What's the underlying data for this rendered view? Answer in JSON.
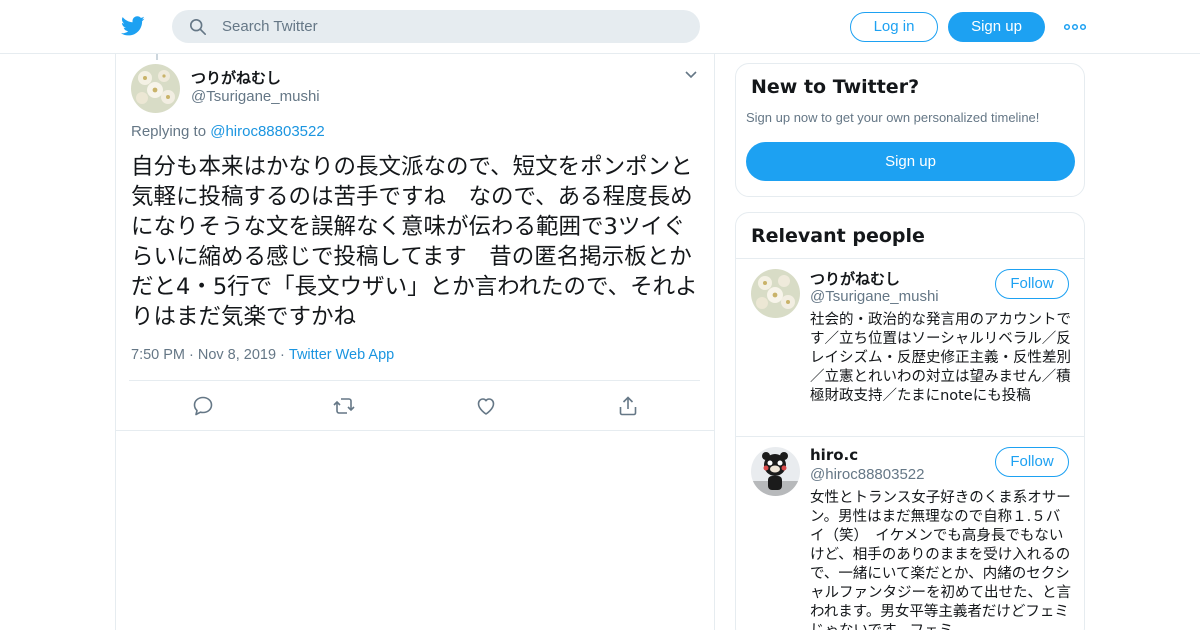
{
  "header": {
    "logo": "twitter-bird-icon",
    "search_placeholder": "Search Twitter",
    "login_label": "Log in",
    "signup_label": "Sign up",
    "more": "more-dots-icon",
    "brand_color": "#1da1f2"
  },
  "tweet": {
    "name": "つりがねむし",
    "handle": "@Tsurigane_mushi",
    "replying_prefix": "Replying to ",
    "replying_to": "@hiroc88803522",
    "text": "自分も本来はかなりの長文派なので、短文をポンポンと気軽に投稿するのは苦手ですね　なので、ある程度長めになりそうな文を誤解なく意味が伝わる範囲で3ツイぐらいに縮める感じで投稿してます　昔の匿名掲示板とかだと4・5行で「長文ウザい」とか言われたので、それよりはまだ気楽ですかね",
    "time": "7:50 PM",
    "date": "Nov 8, 2019",
    "source": "Twitter Web App",
    "separator": "·"
  },
  "sidebar": {
    "new_to_twitter": {
      "title": "New to Twitter?",
      "subtitle": "Sign up now to get your own personalized timeline!",
      "signup_label": "Sign up"
    },
    "relevant": {
      "title": "Relevant people",
      "people": [
        {
          "name": "つりがねむし",
          "handle": "@Tsurigane_mushi",
          "follow_label": "Follow",
          "bio": "社会的・政治的な発言用のアカウントです／立ち位置はソーシャルリベラル／反レイシズム・反歴史修正主義・反性差別／立憲とれいわの対立は望みません／積極財政支持／たまにnoteにも投稿"
        },
        {
          "name": "hiro.c",
          "handle": "@hiroc88803522",
          "follow_label": "Follow",
          "bio": "女性とトランス女子好きのくま系オサーン。男性はまだ無理なので自称１.５バイ（笑）　イケメンでも高身長でもないけど、相手のありのままを受け入れるので、一緒にいて楽だとか、内緒のセクシャルファンタジーを初めて出せた、と言われます。男女平等主義者だけどフェミじゃないです。フェミ"
        }
      ]
    }
  }
}
